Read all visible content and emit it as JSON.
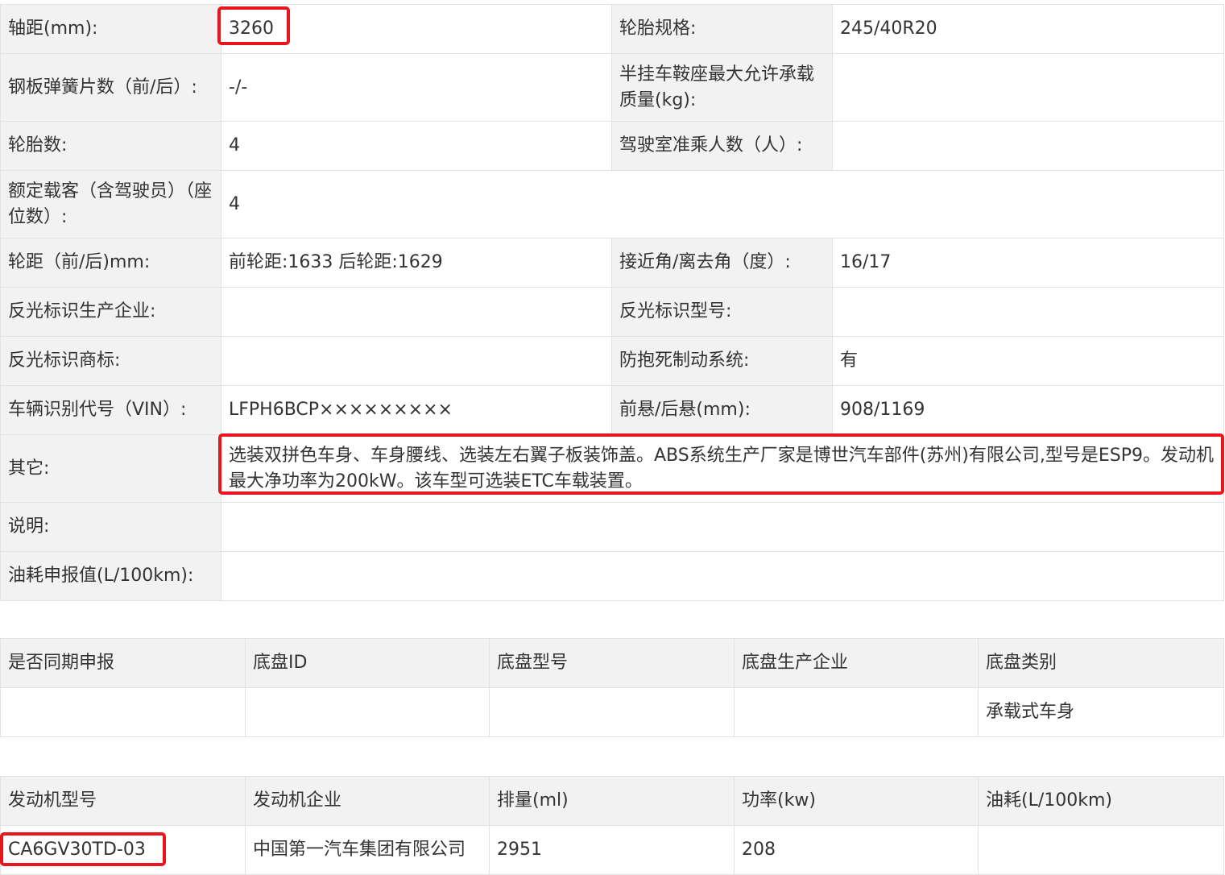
{
  "spec": {
    "rows": [
      [
        {
          "label": "轴距(mm):",
          "value": "3260"
        },
        {
          "label": "轮胎规格:",
          "value": "245/40R20"
        }
      ],
      [
        {
          "label": "钢板弹簧片数（前/后）:",
          "value": "-/-"
        },
        {
          "label": "半挂车鞍座最大允许承载质量(kg):",
          "value": ""
        }
      ],
      [
        {
          "label": "轮胎数:",
          "value": "4"
        },
        {
          "label": "驾驶室准乘人数（人）:",
          "value": ""
        }
      ],
      [
        {
          "label": "额定载客（含驾驶员）（座位数）:",
          "value": "4"
        }
      ],
      [
        {
          "label": "轮距（前/后)mm:",
          "value": "前轮距:1633 后轮距:1629"
        },
        {
          "label": "接近角/离去角（度）:",
          "value": "16/17"
        }
      ],
      [
        {
          "label": "反光标识生产企业:",
          "value": ""
        },
        {
          "label": "反光标识型号:",
          "value": ""
        }
      ],
      [
        {
          "label": "反光标识商标:",
          "value": ""
        },
        {
          "label": "防抱死制动系统:",
          "value": "有"
        }
      ],
      [
        {
          "label": "车辆识别代号（VIN）:",
          "value": "LFPH6BCP×××××××××"
        },
        {
          "label": "前悬/后悬(mm):",
          "value": "908/1169"
        }
      ],
      [
        {
          "label": "其它:",
          "value": "选装双拼色车身、车身腰线、选装左右翼子板装饰盖。ABS系统生产厂家是博世汽车部件(苏州)有限公司,型号是ESP9。发动机最大净功率为200kW。该车型可选装ETC车载装置。"
        }
      ],
      [
        {
          "label": "说明:",
          "value": ""
        }
      ],
      [
        {
          "label": "油耗申报值(L/100km):",
          "value": ""
        }
      ]
    ]
  },
  "chassis": {
    "headers": [
      "是否同期申报",
      "底盘ID",
      "底盘型号",
      "底盘生产企业",
      "底盘类别"
    ],
    "row": [
      "",
      "",
      "",
      "",
      "承载式车身"
    ]
  },
  "engine": {
    "headers": [
      "发动机型号",
      "发动机企业",
      "排量(ml)",
      "功率(kw)",
      "油耗(L/100km)"
    ],
    "row": [
      "CA6GV30TD-03",
      "中国第一汽车集团有限公司",
      "2951",
      "208",
      ""
    ]
  },
  "highlight_color": "#e8161c"
}
